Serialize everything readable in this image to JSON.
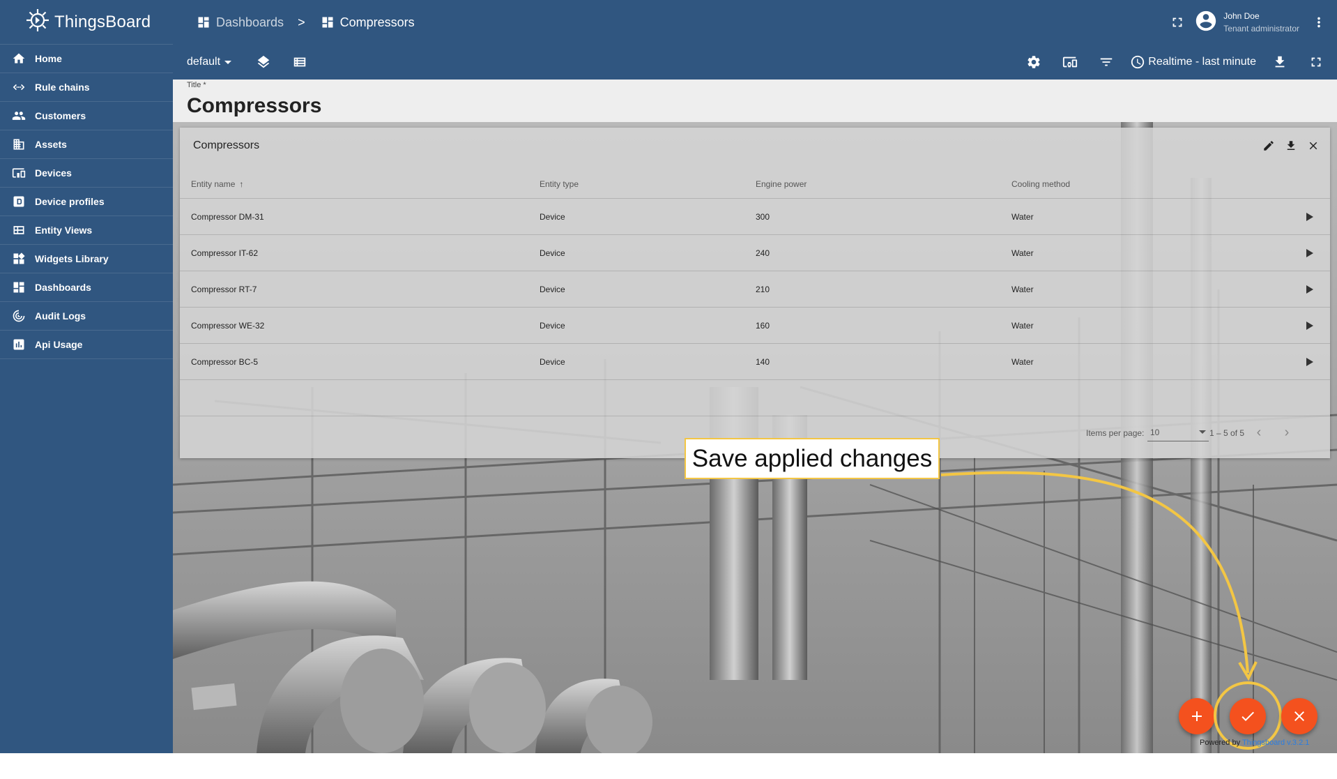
{
  "app": {
    "name": "ThingsBoard"
  },
  "sidebar": {
    "items": [
      {
        "label": "Home",
        "icon": "home-icon"
      },
      {
        "label": "Rule chains",
        "icon": "rule-chains-icon"
      },
      {
        "label": "Customers",
        "icon": "customers-icon"
      },
      {
        "label": "Assets",
        "icon": "assets-icon"
      },
      {
        "label": "Devices",
        "icon": "devices-icon"
      },
      {
        "label": "Device profiles",
        "icon": "device-profiles-icon"
      },
      {
        "label": "Entity Views",
        "icon": "entity-views-icon"
      },
      {
        "label": "Widgets Library",
        "icon": "widgets-library-icon"
      },
      {
        "label": "Dashboards",
        "icon": "dashboards-icon"
      },
      {
        "label": "Audit Logs",
        "icon": "audit-logs-icon"
      },
      {
        "label": "Api Usage",
        "icon": "api-usage-icon"
      }
    ]
  },
  "breadcrumb": {
    "parent": "Dashboards",
    "separator": ">",
    "current": "Compressors"
  },
  "user": {
    "name": "John Doe",
    "role": "Tenant administrator"
  },
  "toolbar": {
    "layout": "default",
    "time_window": "Realtime - last minute"
  },
  "title_field": {
    "label": "Title *",
    "value": "Compressors"
  },
  "widget": {
    "title": "Compressors",
    "columns": [
      "Entity name",
      "Entity type",
      "Engine power",
      "Cooling method"
    ],
    "sort_indicator": "↑",
    "rows": [
      {
        "name": "Compressor DM-31",
        "type": "Device",
        "power": "300",
        "cooling": "Water"
      },
      {
        "name": "Compressor IT-62",
        "type": "Device",
        "power": "240",
        "cooling": "Water"
      },
      {
        "name": "Compressor RT-7",
        "type": "Device",
        "power": "210",
        "cooling": "Water"
      },
      {
        "name": "Compressor WE-32",
        "type": "Device",
        "power": "160",
        "cooling": "Water"
      },
      {
        "name": "Compressor BC-5",
        "type": "Device",
        "power": "140",
        "cooling": "Water"
      }
    ],
    "pager": {
      "items_per_page_label": "Items per page:",
      "items_per_page": "10",
      "range": "1 – 5 of 5"
    }
  },
  "callout": {
    "text": "Save applied changes",
    "color": "#f3c644"
  },
  "footer": {
    "powered_prefix": "Powered by",
    "powered_link": "Thingsboard v.3.2.1"
  },
  "colors": {
    "primary": "#305680",
    "accent": "#f4511e"
  }
}
